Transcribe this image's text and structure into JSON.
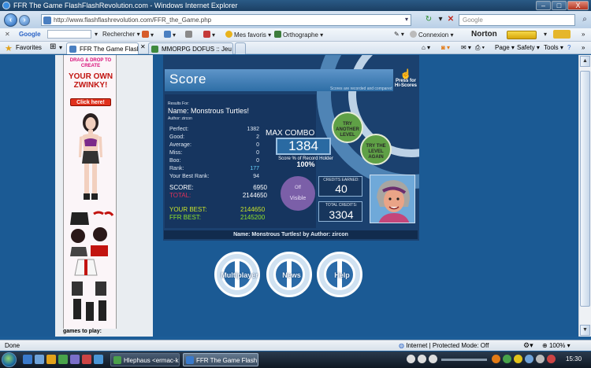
{
  "window": {
    "title": "FFR The Game FlashFlashRevolution.com - Windows Internet Explorer",
    "minimize": "–",
    "maximize": "□",
    "close": "X"
  },
  "address": {
    "url": "http://www.flashflashrevolution.com/FFR_the_Game.php",
    "search_placeholder": "Google"
  },
  "google_toolbar": {
    "logo": "Google",
    "search_label": "Rechercher",
    "favoris": "Mes favoris",
    "orthographe": "Orthographe",
    "connexion": "Connexion",
    "norton": "Norton"
  },
  "favorites_bar": {
    "label": "Favorites",
    "tabs": [
      {
        "label": "FFR The Game FlashFl..."
      },
      {
        "label": "MMORPG DOFUS :: Jeu de ..."
      }
    ],
    "commands": {
      "page": "Page",
      "safety": "Safety",
      "tools": "Tools"
    }
  },
  "ad": {
    "line1": "DRAG & DROP TO CREATE",
    "line2": "YOUR OWN ZWINKY!",
    "button": "Click here!",
    "footer": "games to play:"
  },
  "game": {
    "title": "Score",
    "press_for": "Press for Hi-Scores",
    "recorded": "Scores are recorded and compared",
    "results_for": "Results For:",
    "song": "Name: Monstrous Turtles!",
    "author": "Author: zircon",
    "stats": [
      {
        "label": "Perfect:",
        "value": "1382"
      },
      {
        "label": "Good:",
        "value": "2"
      },
      {
        "label": "Average:",
        "value": "0"
      },
      {
        "label": "Miss:",
        "value": "0"
      },
      {
        "label": "Boo:",
        "value": "0"
      },
      {
        "label": "Rank:",
        "value": "177"
      },
      {
        "label": "Your Best Rank:",
        "value": "94"
      }
    ],
    "max_combo_label": "MAX COMBO",
    "max_combo": "1384",
    "record_text": "Score % of Record Holder",
    "record_pct": "100%",
    "score_label": "SCORE:",
    "score": "6950",
    "total_label": "TOTAL:",
    "total": "2144650",
    "your_best_label": "YOUR BEST:",
    "your_best": "2144650",
    "ffr_best_label": "FFR BEST:",
    "ffr_best": "2145200",
    "off": "Off",
    "visible": "Visible",
    "credits_label": "CREDITS EARNED:",
    "credits": "40",
    "total_credits_label": "TOTAL CREDITS:",
    "total_credits": "3304",
    "try_another": "TRY ANOTHER LEVEL",
    "try_again": "TRY THE LEVEL AGAIN",
    "song_bar": "Name: Monstrous Turtles! by Author: zircon"
  },
  "menu": {
    "multiplayer": "Multiplayer",
    "news": "News",
    "help": "Help"
  },
  "status": {
    "done": "Done",
    "zone": "Internet | Protected Mode: Off",
    "zoom": "100%"
  },
  "taskbar": {
    "tasks": [
      {
        "label": "Hlephaus <ermac-k..."
      },
      {
        "label": "FFR The Game Flash..."
      }
    ],
    "clock": "15:30"
  },
  "colors": {
    "game_bg": "#1b416f",
    "page_bg": "#1b5a94",
    "accent_green": "#5fa046"
  }
}
